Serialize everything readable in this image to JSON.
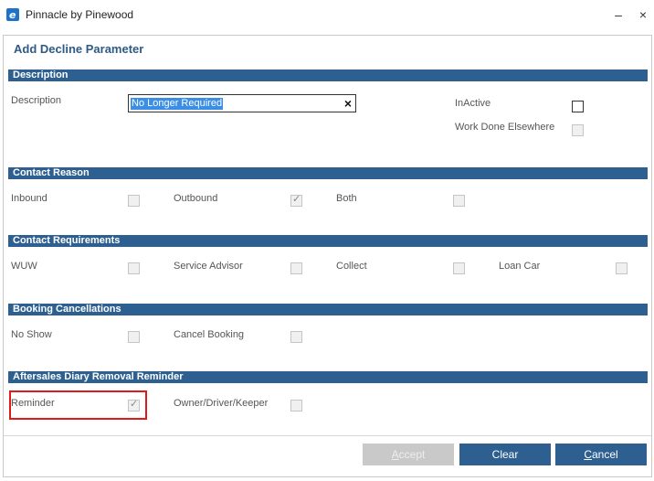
{
  "window": {
    "title": "Pinnacle by Pinewood",
    "minimize": "–",
    "close": "×"
  },
  "dialog": {
    "title": "Add Decline Parameter"
  },
  "sections": {
    "description": {
      "header": "Description",
      "desc_label": "Description",
      "desc_value": "No Longer Required",
      "inactive_label": "InActive",
      "work_done_label": "Work Done Elsewhere"
    },
    "contact_reason": {
      "header": "Contact Reason",
      "inbound": "Inbound",
      "outbound": "Outbound",
      "both": "Both"
    },
    "contact_requirements": {
      "header": "Contact Requirements",
      "wuw": "WUW",
      "service_advisor": "Service Advisor",
      "collect": "Collect",
      "loan_car": "Loan Car"
    },
    "booking_cancellations": {
      "header": "Booking Cancellations",
      "no_show": "No Show",
      "cancel_booking": "Cancel Booking"
    },
    "aftersales": {
      "header": "Aftersales Diary Removal Reminder",
      "reminder": "Reminder",
      "owner": "Owner/Driver/Keeper"
    }
  },
  "buttons": {
    "accept": "ccept",
    "accept_key": "A",
    "clear": "Clear",
    "cancel": "ancel",
    "cancel_key": "C"
  },
  "checkmark": "✓"
}
